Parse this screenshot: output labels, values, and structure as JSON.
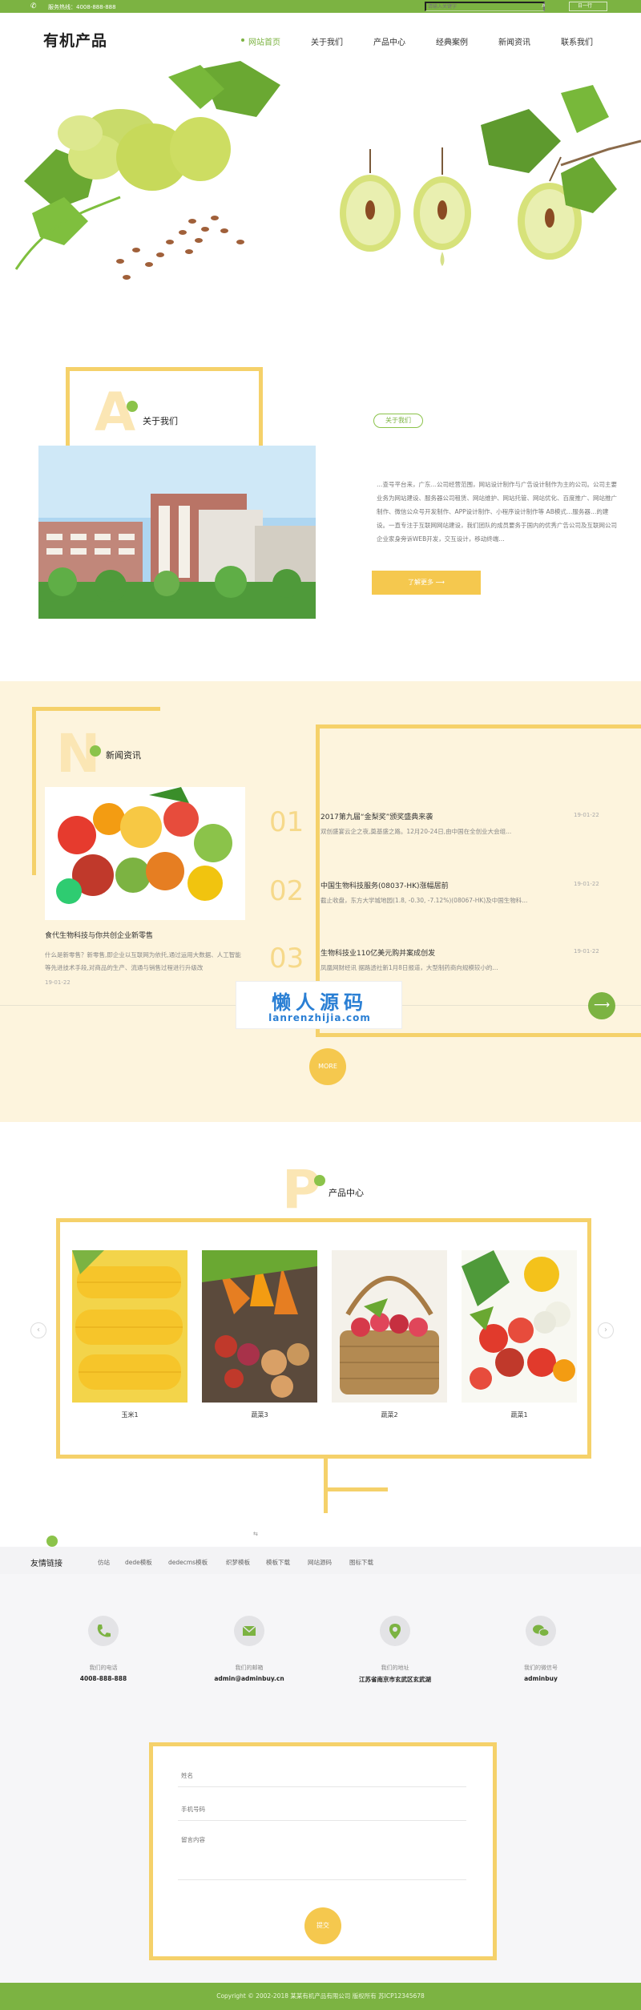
{
  "topbar": {
    "hotline": "服务热线：4008-888-888",
    "search_placeholder": "请输入关键字",
    "language": "日一行"
  },
  "header": {
    "logo": "有机产品",
    "nav": [
      "网站首页",
      "关于我们",
      "产品中心",
      "经典案例",
      "新闻资讯",
      "联系我们"
    ]
  },
  "about": {
    "letter": "A",
    "title": "关于我们",
    "pill": "关于我们",
    "text": "…查号平台来，广东…公司经营范围，网站设计制作与广告设计制作为主的公司。公司主要业务为网站建设、服务器公司租赁、网站维护、网站托管、网站优化、百度推广、网站推广制作、微信公众号开发制作、APP设计制作、小程序设计制作等 AB模式…服务器…的建设。一直专注于互联网网站建设，我们团队的成员要务于国内的优秀广告公司及互联网公司企业家身旁诉WEB开发，交互设计，移动终端…",
    "more": "了解更多 ⟶"
  },
  "news": {
    "letter": "N",
    "title": "新闻资讯",
    "featured": {
      "title": "食代生物科技与你共创企业新零售",
      "desc": "什么是新零售？新零售,即企业以互联网为依托,通过运用大数据、人工智能等先进技术手段,对商品的生产、流通与销售过程进行升级改",
      "date": "19-01-22"
    },
    "items": [
      {
        "num": "01",
        "title": "2017第九届“金梨奖”颁奖盛典来袭",
        "desc": "双创盛宴云企之夜,奠基盛之路。12月20-24日,由中国在全创业大会组...",
        "date": "19-01-22"
      },
      {
        "num": "02",
        "title": "中国生物科技服务(08037-HK)涨幅居前",
        "desc": "截止收盘，东方大学城地园(1.8, -0.30, -7.12%)(08067-HK)及中国生物科...",
        "date": "19-01-22"
      },
      {
        "num": "03",
        "title": "生物科技业110亿美元购并案成创发",
        "desc": "凤凰网财经讯 据路透社新1月8日报道，大型制药商向规模较小的...",
        "date": "19-01-22"
      }
    ],
    "more": "MORE",
    "watermark_cn": "懒人源码",
    "watermark_en": "lanrenzhijia.com"
  },
  "products": {
    "letter": "P",
    "title": "产品中心",
    "items": [
      {
        "name": "玉米1"
      },
      {
        "name": "蔬菜3"
      },
      {
        "name": "蔬菜2"
      },
      {
        "name": "蔬菜1"
      }
    ],
    "pager": "⇆"
  },
  "links": {
    "title": "友情链接",
    "items": [
      "仿站",
      "dede模板",
      "dedecms模板",
      "织梦模板",
      "模板下载",
      "网站源码",
      "图标下载"
    ]
  },
  "contact": {
    "items": [
      {
        "icon": "phone-icon",
        "label": "我们的电话",
        "value": "4008-888-888"
      },
      {
        "icon": "mail-icon",
        "label": "我们的邮箱",
        "value": "admin@adminbuy.cn"
      },
      {
        "icon": "location-icon",
        "label": "我们的地址",
        "value": "江苏省南京市玄武区玄武湖"
      },
      {
        "icon": "wechat-icon",
        "label": "我们的微信号",
        "value": "adminbuy"
      }
    ],
    "form": {
      "name_placeholder": "姓名",
      "phone_placeholder": "手机号码",
      "message_placeholder": "留言内容",
      "submit": "提交"
    }
  },
  "footer": {
    "copyright": "Copyright © 2002-2018 某某有机产品有限公司 版权所有 苏ICP12345678"
  },
  "colors": {
    "green": "#7cb342",
    "yellow": "#f5d16a",
    "cream": "#fdf4dd"
  }
}
